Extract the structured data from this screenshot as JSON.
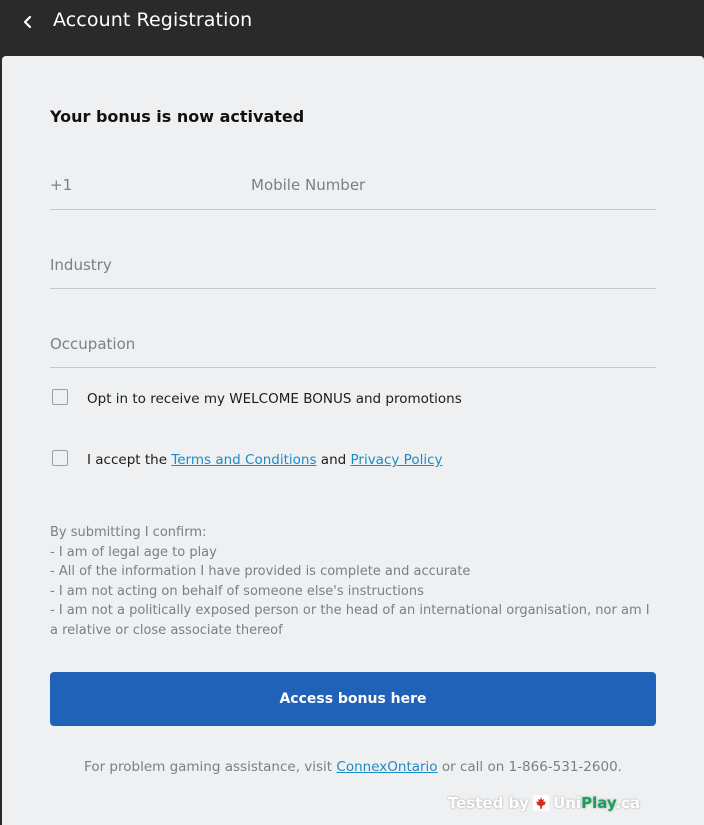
{
  "header": {
    "title": "Account Registration",
    "back_icon": "chevron-left-icon"
  },
  "form": {
    "heading": "Your bonus is now activated",
    "country_code": "+1",
    "mobile_placeholder": "Mobile Number",
    "industry_placeholder": "Industry",
    "occupation_placeholder": "Occupation",
    "optin_label": "Opt in to receive my WELCOME BONUS and promotions",
    "terms_prefix": "I accept the ",
    "terms_link": "Terms and Conditions",
    "terms_mid": " and ",
    "privacy_link": "Privacy Policy"
  },
  "disclaimer": [
    "By submitting I confirm:",
    "- I am of legal age to play",
    "- All of the information I have provided is complete and accurate",
    "- I am not acting on behalf of someone else's instructions",
    "- I am not a politically exposed person or the head of an international organisation, nor am I a relative or close associate thereof"
  ],
  "cta": {
    "label": "Access bonus here"
  },
  "help": {
    "prefix": "For problem gaming assistance, visit ",
    "link": "ConnexOntario",
    "suffix": " or call on 1-866-531-2600."
  },
  "watermark": {
    "tested_by": "Tested by",
    "brand_uni": "Uni",
    "brand_play": "Play",
    "brand_tld": ".ca"
  },
  "colors": {
    "header_bg": "#2b2a2a",
    "card_bg": "#eef0f2",
    "primary_button": "#1f62b8",
    "link": "#1f8bc4",
    "muted_text": "#7a8087"
  }
}
